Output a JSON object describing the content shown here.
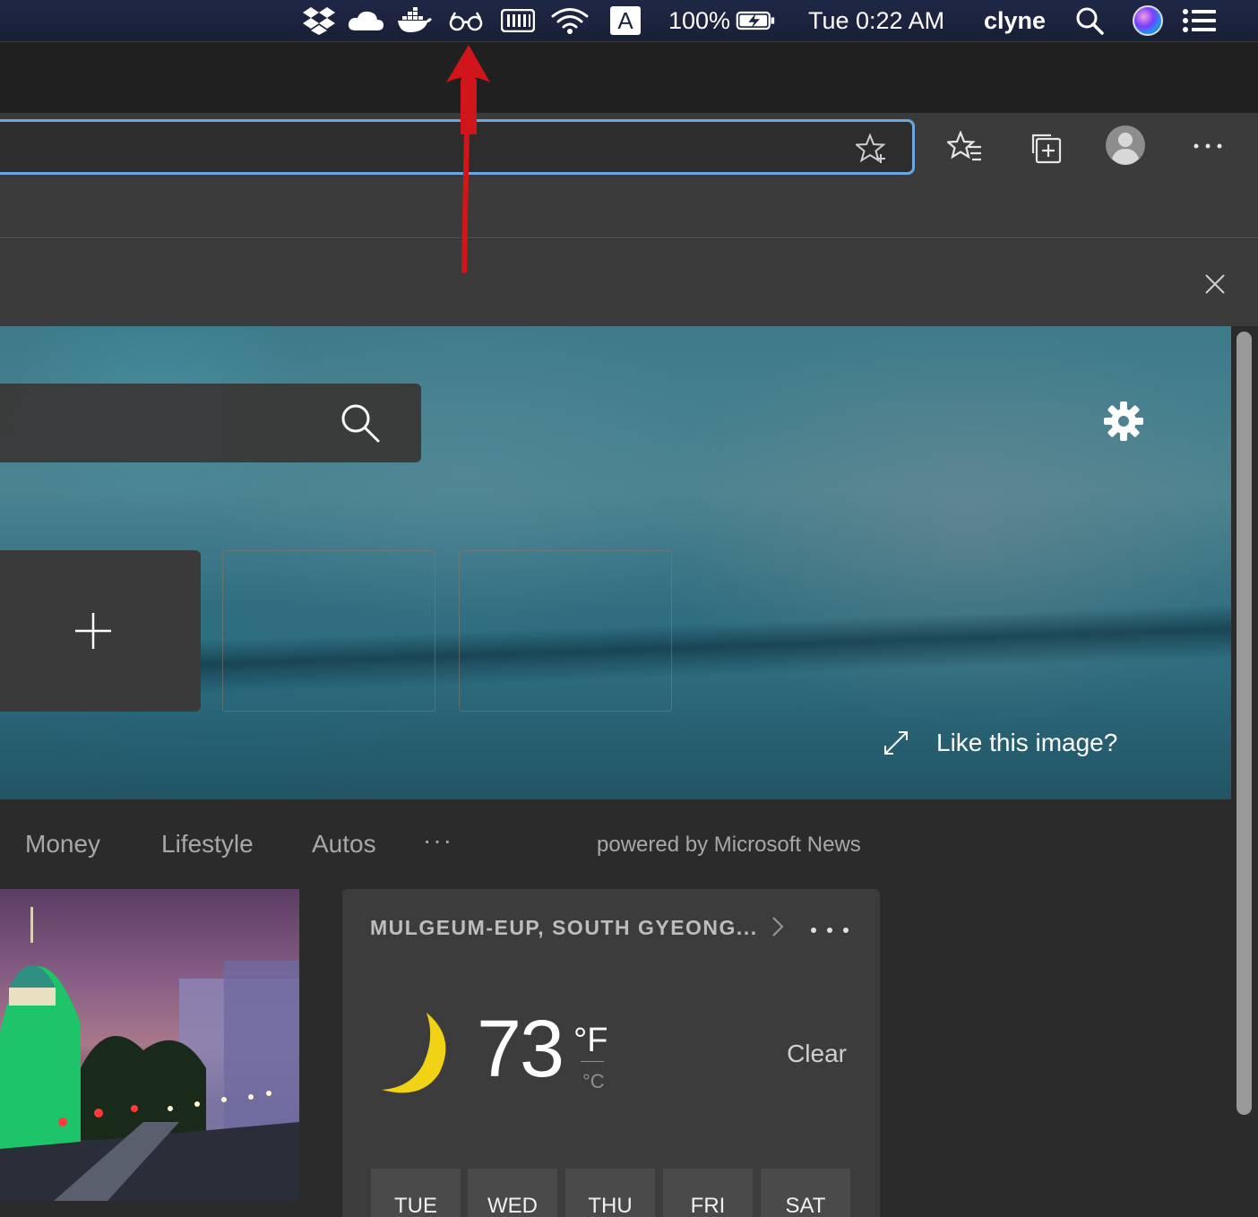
{
  "menubar": {
    "battery_percent": "100%",
    "clock": "Tue 0:22 AM",
    "username": "clyne",
    "input_source": "A"
  },
  "toolbar": {
    "address_value": "",
    "icons": [
      "add-favorite-icon",
      "favorites-icon",
      "collections-icon",
      "profile-icon",
      "more-icon"
    ]
  },
  "hero": {
    "like_label": "Like this image?"
  },
  "news_nav": {
    "links": [
      "Money",
      "Lifestyle",
      "Autos"
    ],
    "more_label": "···",
    "powered_by": "powered by Microsoft News"
  },
  "weather": {
    "location": "MULGEUM-EUP, SOUTH GYEONG...",
    "temperature": "73",
    "unit_f": "°F",
    "unit_c": "°C",
    "condition": "Clear",
    "days": [
      "TUE",
      "WED",
      "THU",
      "FRI",
      "SAT"
    ]
  },
  "colors": {
    "accent": "#6aa7e0",
    "annotation_arrow": "#d0151b",
    "moon": "#f2d214"
  }
}
